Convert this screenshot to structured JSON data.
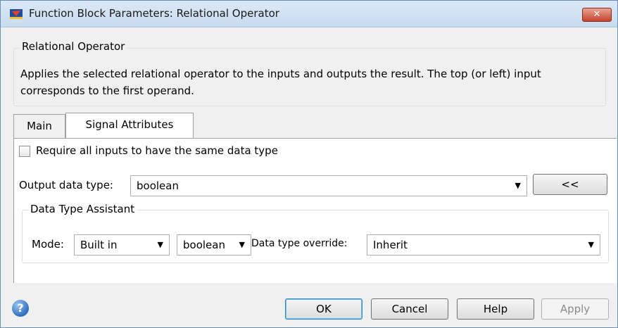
{
  "window": {
    "title": "Function Block Parameters: Relational Operator",
    "close_label": "✕"
  },
  "block": {
    "name": "Relational Operator",
    "description": "Applies the selected relational operator to the inputs and outputs the result. The top (or left) input corresponds to the first operand."
  },
  "tabs": [
    {
      "label": "Main",
      "active": false
    },
    {
      "label": "Signal Attributes",
      "active": true
    }
  ],
  "signal_attributes": {
    "require_same_type_label": "Require all inputs to have the same data type",
    "require_same_type_checked": false,
    "output_type_label": "Output data type:",
    "output_type_value": "boolean",
    "assistant_toggle_label": "<<",
    "assistant": {
      "title": "Data Type Assistant",
      "mode_label": "Mode:",
      "mode_value": "Built in",
      "builtin_value": "boolean",
      "override_label": "Data type override:",
      "override_value": "Inherit"
    }
  },
  "footer": {
    "ok_label": "OK",
    "cancel_label": "Cancel",
    "help_label": "Help",
    "apply_label": "Apply"
  },
  "icons": {
    "app": "simulink-block-icon",
    "help": "help-circle-icon",
    "dropdown": "dropdown-arrow-icon"
  }
}
